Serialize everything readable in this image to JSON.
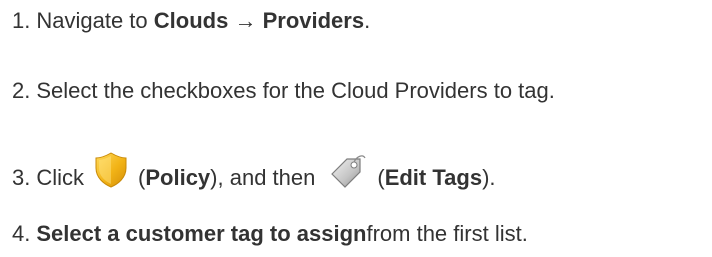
{
  "steps": [
    {
      "number": "1.",
      "text_before": "Navigate to",
      "bold_1": "Clouds",
      "arrow": "→",
      "bold_2": "Providers",
      "text_after": "."
    },
    {
      "number": "2.",
      "text": "Select the checkboxes for the Cloud Providers to tag."
    },
    {
      "number": "3.",
      "click_text": "Click",
      "policy_paren_open": "(",
      "policy_label": "Policy",
      "policy_paren_close": "), and then",
      "edit_paren_open": "(",
      "edit_label": "Edit Tags",
      "edit_paren_close": ")."
    },
    {
      "number": "4.",
      "bold": "Select a customer tag to assign",
      "text_after": "from the first list."
    }
  ],
  "icons": {
    "policy": "shield-icon",
    "edit_tags": "tag-icon"
  },
  "colors": {
    "text": "#333333",
    "shield_gold": "#f2b316",
    "tag_gray": "#bfbfbf"
  }
}
